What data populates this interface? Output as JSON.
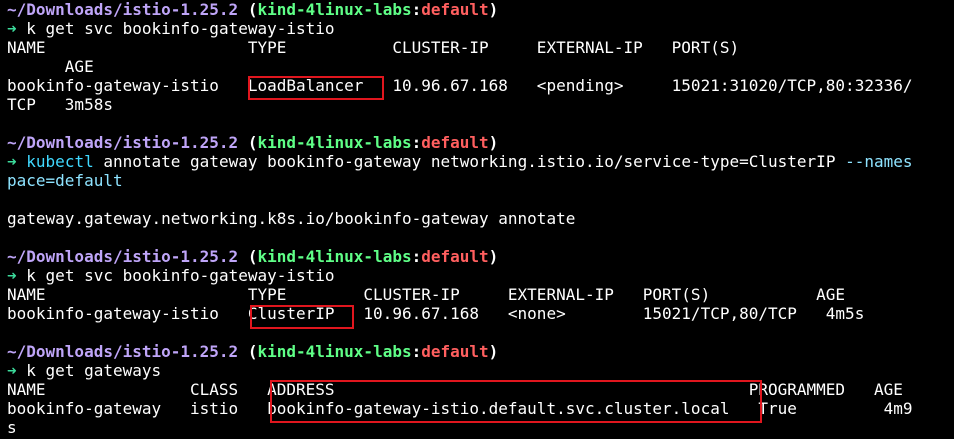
{
  "prompt": {
    "cwd": "~/Downloads/istio-1.25.2",
    "context": "kind-4linux-labs",
    "namespace": "default",
    "arrow": "➜"
  },
  "blocks": [
    {
      "command": "k get svc bookinfo-gateway-istio",
      "output": [
        "NAME                     TYPE           CLUSTER-IP     EXTERNAL-IP   PORT(S)",
        "      AGE",
        "bookinfo-gateway-istio   LoadBalancer   10.96.67.168   <pending>     15021:31020/TCP,80:32336/",
        "TCP   3m58s"
      ]
    },
    {
      "command_program": "kubectl",
      "command_args": " annotate gateway bookinfo-gateway networking.istio.io/service-type=ClusterIP ",
      "command_flag_1": "--names",
      "command_flag_2": "pace=default",
      "output": [
        "gateway.gateway.networking.k8s.io/bookinfo-gateway annotate"
      ]
    },
    {
      "command": "k get svc bookinfo-gateway-istio",
      "output": [
        "NAME                     TYPE        CLUSTER-IP     EXTERNAL-IP   PORT(S)           AGE",
        "bookinfo-gateway-istio   ClusterIP   10.96.67.168   <none>        15021/TCP,80/TCP   4m5s"
      ]
    },
    {
      "command": "k get gateways",
      "output": [
        "NAME               CLASS   ADDRESS                                           PROGRAMMED   AGE",
        "bookinfo-gateway   istio   bookinfo-gateway-istio.default.svc.cluster.local   True         4m9",
        "s"
      ]
    }
  ],
  "colors": {
    "background": "#000000",
    "cwd": "#bfa5f8",
    "context": "#5fff87",
    "namespace": "#ff5f5f",
    "arrow": "#3cdc9c",
    "highlight_box": "#e0161e"
  }
}
